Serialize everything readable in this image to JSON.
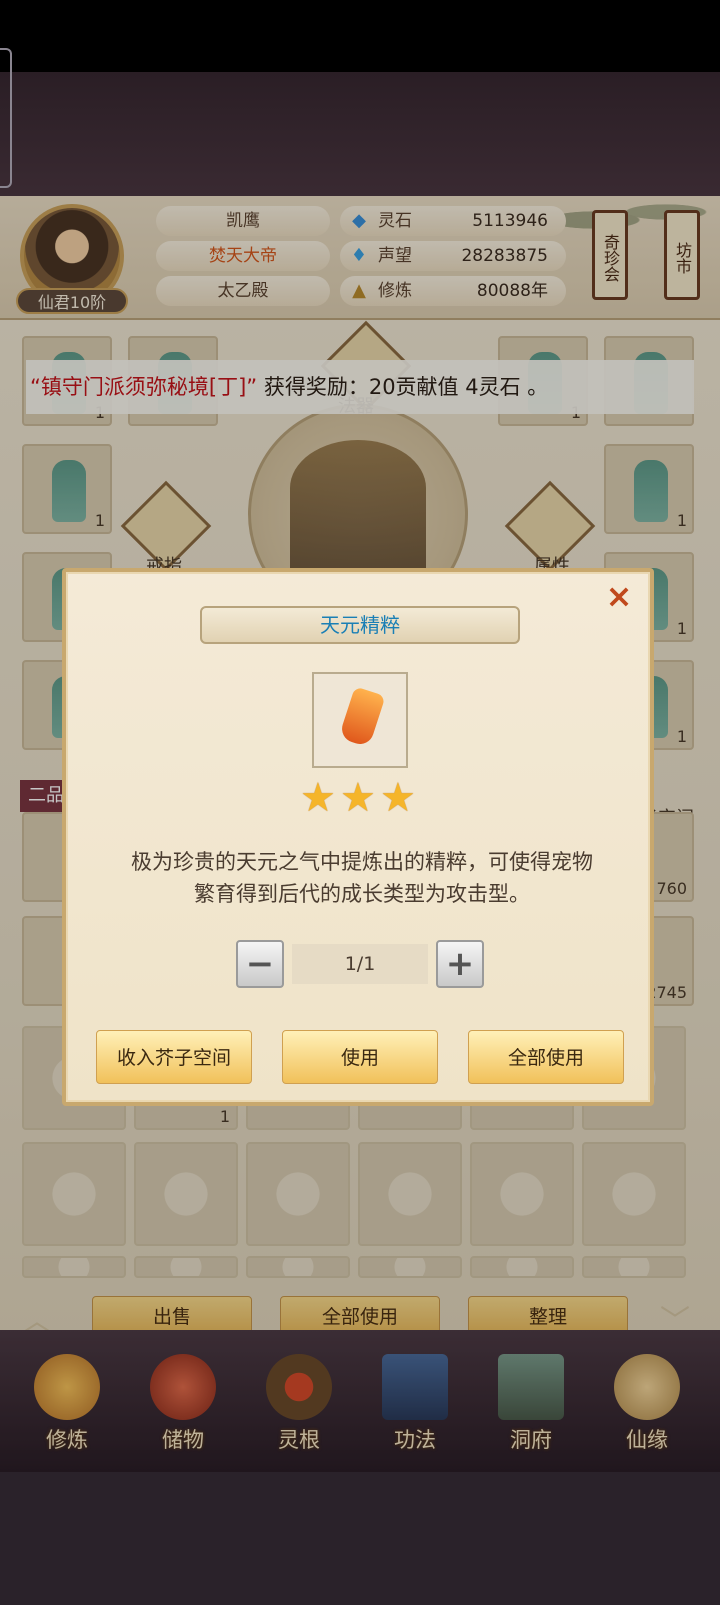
{
  "player": {
    "rank": "仙君10阶",
    "names": [
      "凯鹰",
      "焚天大帝",
      "太乙殿"
    ],
    "stats": [
      {
        "icon": "spirit-stone-icon",
        "glyph": "◆",
        "label": "灵石",
        "value": "5113946"
      },
      {
        "icon": "reputation-icon",
        "glyph": "♦",
        "label": "声望",
        "value": "28283875"
      },
      {
        "icon": "cultivation-icon",
        "glyph": "▲",
        "label": "修炼",
        "value": "80088年"
      }
    ]
  },
  "hangers": [
    "奇珍会",
    "坊市"
  ],
  "equip_labels": {
    "ring": "戒指",
    "attr": "属性",
    "method": "法器"
  },
  "grade_label": "二品",
  "inventory_counts": [
    "1",
    "1",
    "1",
    "1",
    "1",
    "1",
    "1",
    "760",
    "2745",
    "1"
  ],
  "side_label": "子空间",
  "banner": {
    "event": "“镇守门派须弥秘境[丁]”",
    "reward": " 获得奖励：20贡献值 4灵石 。"
  },
  "dialog": {
    "title": "天元精粹",
    "stars": 3,
    "description_line1": "极为珍贵的天元之气中提炼出的精粹，可使得宠物",
    "description_line2": "繁育得到后代的成长类型为攻击型。",
    "minus": "−",
    "plus": "+",
    "quantity": "1/1",
    "buttons": [
      "收入芥子空间",
      "使用",
      "全部使用"
    ],
    "close": "×"
  },
  "bottom_actions": [
    "出售",
    "全部使用",
    "整理"
  ],
  "nav": [
    {
      "label": "修炼",
      "icon": "cultivate-icon"
    },
    {
      "label": "储物",
      "icon": "storage-bag-icon"
    },
    {
      "label": "灵根",
      "icon": "spirit-root-icon"
    },
    {
      "label": "功法",
      "icon": "skill-book-icon"
    },
    {
      "label": "洞府",
      "icon": "cave-dwelling-icon"
    },
    {
      "label": "仙缘",
      "icon": "immortal-fate-icon"
    }
  ]
}
